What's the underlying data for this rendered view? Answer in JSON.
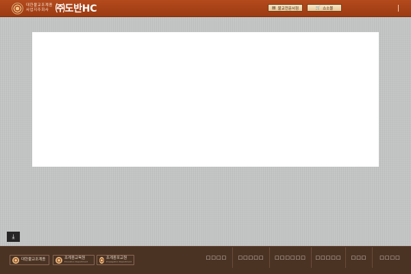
{
  "header": {
    "logo_line1": "대한불교조계종",
    "logo_line2": "사업지주회사",
    "logo_main": "㈜도반HC",
    "buttons": [
      {
        "label": "불교전문서점",
        "icon": "book-icon"
      },
      {
        "label": "쇼소몰",
        "icon": "cart-icon"
      }
    ]
  },
  "footer": {
    "logos": [
      {
        "title": "대한불교조계종",
        "subtitle": ""
      },
      {
        "title": "조계종교육원",
        "subtitle": "Education Department"
      },
      {
        "title": "조계종포교원",
        "subtitle": "Propagation Department"
      }
    ],
    "nav": [
      "□□□□",
      "□□□□□",
      "□□□□□□",
      "□□□□□",
      "□□□",
      "□□□□"
    ]
  },
  "colors": {
    "header_bg": "#a8421a",
    "footer_bg": "#4b3324",
    "page_bg": "#c3c4c4"
  }
}
